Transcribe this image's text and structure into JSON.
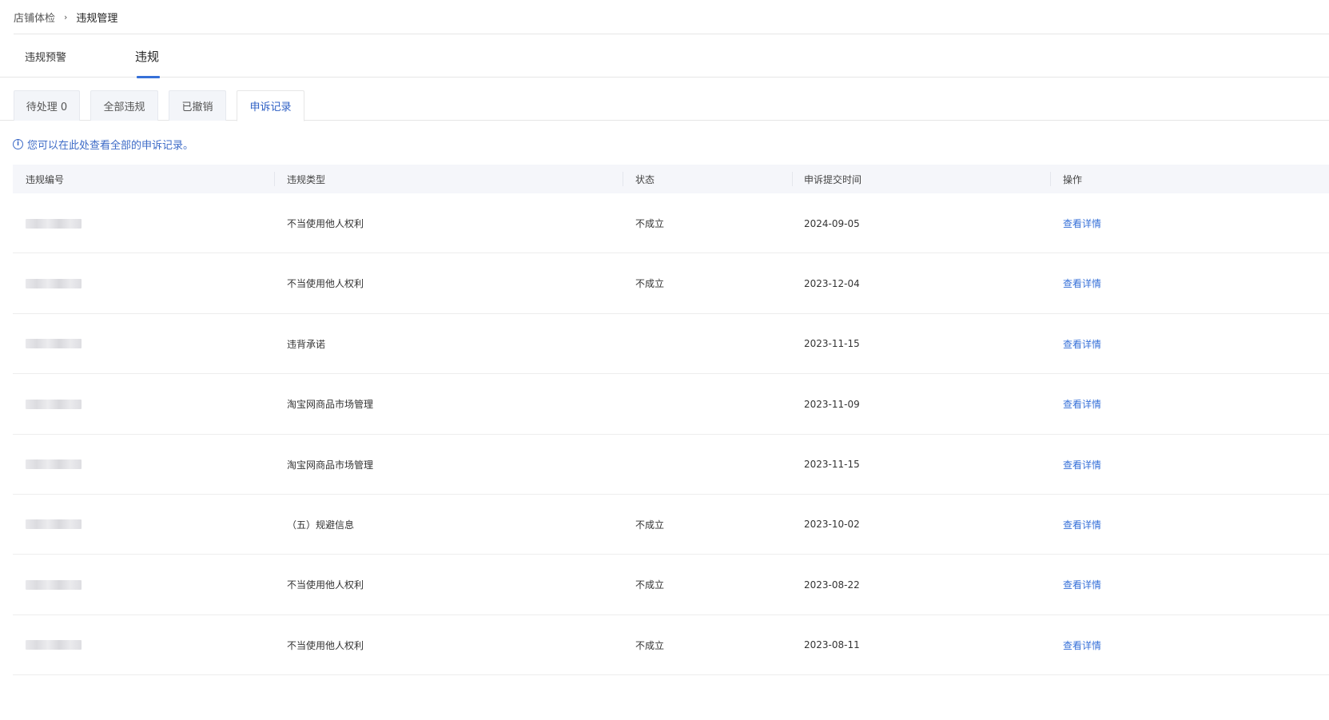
{
  "breadcrumb": {
    "parent": "店铺体检",
    "separator": "›",
    "current": "违规管理"
  },
  "main_tabs": [
    {
      "label": "违规预警",
      "active": false
    },
    {
      "label": "违规",
      "active": true
    }
  ],
  "sub_tabs": [
    {
      "label": "待处理 0",
      "active": false
    },
    {
      "label": "全部违规",
      "active": false
    },
    {
      "label": "已撤销",
      "active": false
    },
    {
      "label": "申诉记录",
      "active": true
    }
  ],
  "info": {
    "icon": "info-icon",
    "icon_glyph": "i",
    "text": "您可以在此处查看全部的申诉记录。"
  },
  "table": {
    "columns": [
      "违规编号",
      "违规类型",
      "状态",
      "申诉提交时间",
      "操作"
    ],
    "rows": [
      {
        "id": "",
        "type": "不当使用他人权利",
        "status": "不成立",
        "time": "2024-09-05",
        "action": "查看详情"
      },
      {
        "id": "",
        "type": "不当使用他人权利",
        "status": "不成立",
        "time": "2023-12-04",
        "action": "查看详情"
      },
      {
        "id": "",
        "type": "违背承诺",
        "status": "",
        "time": "2023-11-15",
        "action": "查看详情"
      },
      {
        "id": "",
        "type": "淘宝网商品市场管理",
        "status": "",
        "time": "2023-11-09",
        "action": "查看详情"
      },
      {
        "id": "",
        "type": "淘宝网商品市场管理",
        "status": "",
        "time": "2023-11-15",
        "action": "查看详情"
      },
      {
        "id": "",
        "type": "（五）规避信息",
        "status": "不成立",
        "time": "2023-10-02",
        "action": "查看详情"
      },
      {
        "id": "",
        "type": "不当使用他人权利",
        "status": "不成立",
        "time": "2023-08-22",
        "action": "查看详情"
      },
      {
        "id": "",
        "type": "不当使用他人权利",
        "status": "不成立",
        "time": "2023-08-11",
        "action": "查看详情"
      }
    ]
  },
  "colors": {
    "accent": "#3670d8",
    "info_text": "#3d6bc7",
    "header_bg": "#f5f6fa",
    "border": "#e6e6e6"
  }
}
